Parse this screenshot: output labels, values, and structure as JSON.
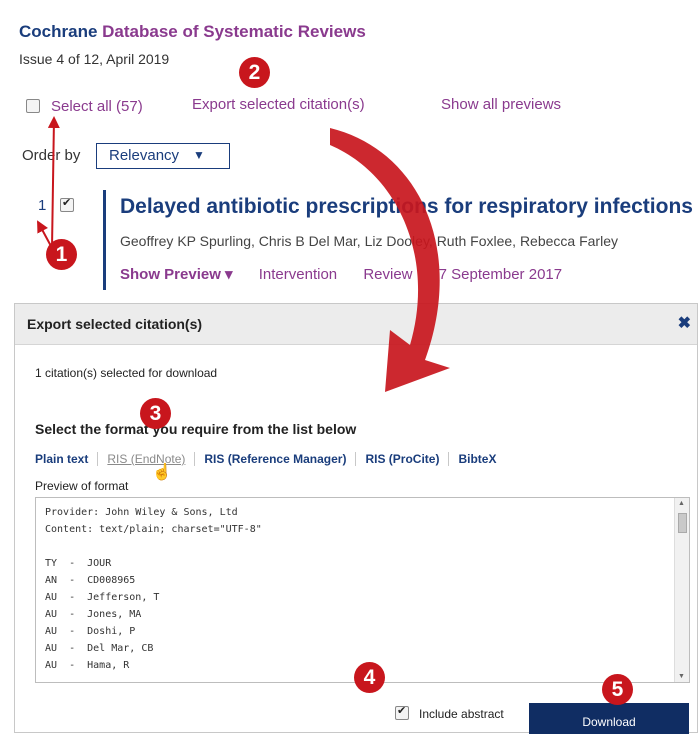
{
  "header": {
    "brand": "Cochrane",
    "title": "Database of Systematic Reviews",
    "issue": "Issue 4 of 12, April 2019"
  },
  "toolbar": {
    "select_all_label": "Select all (57)",
    "export_label": "Export selected citation(s)",
    "show_previews_label": "Show all previews",
    "order_label": "Order by",
    "order_value": "Relevancy",
    "order_caret": "▼"
  },
  "result": {
    "number": "1",
    "title": "Delayed antibiotic prescriptions for respiratory infections",
    "authors": "Geoffrey KP Spurling, Chris B Del Mar, Liz Dooley, Ruth Foxlee, Rebecca Farley",
    "show_preview": "Show Preview ▾",
    "type": "Intervention",
    "status": "Review",
    "date": "7 September 2017"
  },
  "dialog": {
    "title": "Export selected citation(s)",
    "close": "✖",
    "selected_count": "1 citation(s) selected for download",
    "format_heading": "Select the format you require from the list below",
    "formats": [
      "Plain text",
      "RIS (EndNote)",
      "RIS (Reference Manager)",
      "RIS (ProCite)",
      "BibteX"
    ],
    "preview_label": "Preview of format",
    "preview_text": "Provider: John Wiley & Sons, Ltd\nContent: text/plain; charset=\"UTF-8\"\n\nTY  -  JOUR\nAN  -  CD008965\nAU  -  Jefferson, T\nAU  -  Jones, MA\nAU  -  Doshi, P\nAU  -  Del Mar, CB\nAU  -  Hama, R",
    "include_abstract": "Include abstract",
    "download": "Download"
  },
  "annotations": {
    "step1": "1",
    "step2": "2",
    "step3": "3",
    "step4": "4",
    "step5": "5",
    "color": "#c8161d"
  },
  "icons": {
    "scroll_up": "▲",
    "scroll_down": "▼",
    "cursor": "☝"
  }
}
